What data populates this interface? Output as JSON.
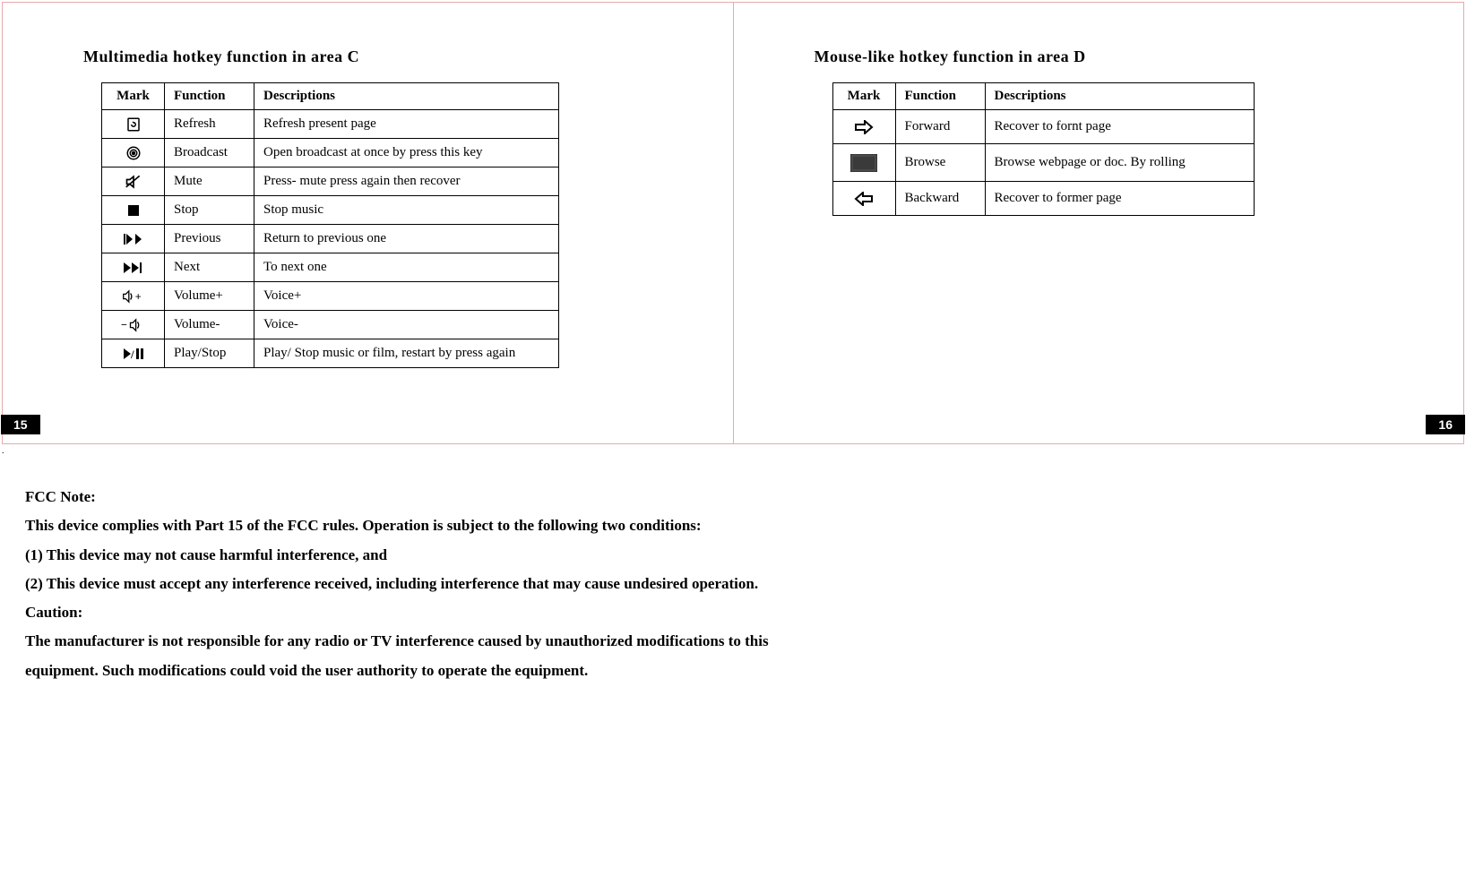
{
  "left": {
    "title": "Multimedia hotkey function in area C",
    "headers": [
      "Mark",
      "Function",
      "Descriptions"
    ],
    "rows": [
      {
        "icon": "refresh-icon",
        "function": "Refresh",
        "desc": "Refresh present page"
      },
      {
        "icon": "broadcast-icon",
        "function": "Broadcast",
        "desc": "Open broadcast at once by press this key"
      },
      {
        "icon": "mute-icon",
        "function": "Mute",
        "desc": "Press- mute press again then recover"
      },
      {
        "icon": "stop-icon",
        "function": "Stop",
        "desc": "Stop music"
      },
      {
        "icon": "previous-icon",
        "function": "Previous",
        "desc": "Return to previous one"
      },
      {
        "icon": "next-icon",
        "function": "Next",
        "desc": "To next one"
      },
      {
        "icon": "volume-up-icon",
        "function": "Volume+",
        "desc": "Voice+"
      },
      {
        "icon": "volume-down-icon",
        "function": "Volume-",
        "desc": "Voice-"
      },
      {
        "icon": "play-stop-icon",
        "function": "Play/Stop",
        "desc": "Play/ Stop music or film, restart by press again"
      }
    ],
    "pageNum": "15"
  },
  "right": {
    "title": "Mouse-like hotkey function in area D",
    "headers": [
      "Mark",
      "Function",
      "Descriptions"
    ],
    "rows": [
      {
        "icon": "forward-arrow-icon",
        "function": "Forward",
        "desc": "Recover to fornt page"
      },
      {
        "icon": "browse-icon",
        "function": "Browse",
        "desc": "Browse webpage or doc. By rolling"
      },
      {
        "icon": "backward-arrow-icon",
        "function": "Backward",
        "desc": "Recover to former page"
      }
    ],
    "pageNum": "16"
  },
  "fcc": {
    "heading": "FCC Note:",
    "line1": "This device complies with Part 15 of the FCC rules. Operation is subject to the following two conditions:",
    "line2": "(1) This device may not cause harmful interference, and",
    "line3": "(2) This device must accept any interference received, including interference that may cause undesired operation.",
    "caution": "Caution:",
    "cautionBody": "The manufacturer is not responsible for any radio or TV interference caused by unauthorized modifications to this equipment. Such modifications could void the user authority to operate the equipment."
  }
}
